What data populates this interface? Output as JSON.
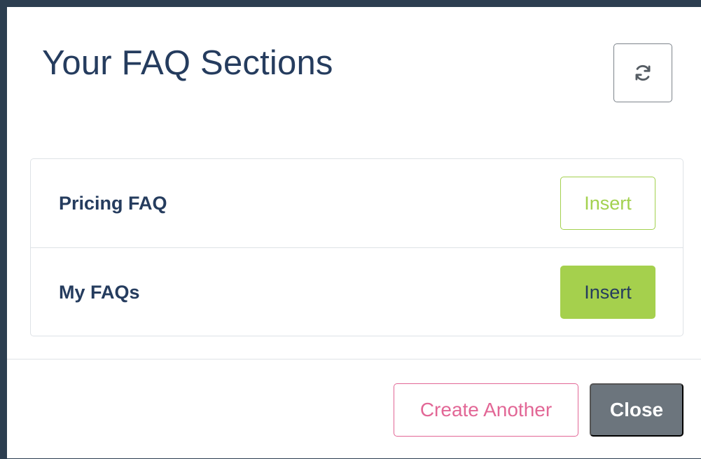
{
  "modal": {
    "title": "Your FAQ Sections",
    "refresh_icon": "refresh-icon"
  },
  "sections": [
    {
      "title": "Pricing FAQ",
      "insert_label": "Insert"
    },
    {
      "title": "My FAQs",
      "insert_label": "Insert"
    }
  ],
  "footer": {
    "create_label": "Create Another",
    "close_label": "Close"
  },
  "colors": {
    "heading": "#253c5e",
    "insert_green": "#a5d04d",
    "create_pink": "#e26796",
    "close_gray": "#6c757d"
  }
}
